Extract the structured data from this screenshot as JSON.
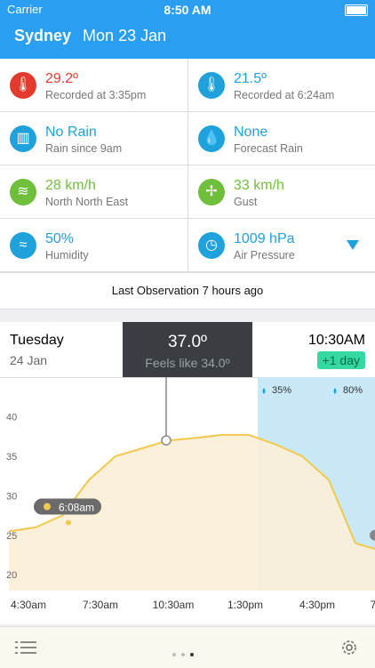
{
  "status": {
    "carrier": "Carrier",
    "time": "8:50 AM"
  },
  "header": {
    "city": "Sydney",
    "date": "Mon 23 Jan"
  },
  "cells": [
    {
      "value": "29.2º",
      "sub": "Recorded at 3:35pm",
      "color": "#e23b2e"
    },
    {
      "value": "21.5º",
      "sub": "Recorded at 6:24am",
      "color": "#1fa1dc"
    },
    {
      "value": "No Rain",
      "sub": "Rain since 9am",
      "color": "#1fa1dc"
    },
    {
      "value": "None",
      "sub": "Forecast Rain",
      "color": "#1fa1dc"
    },
    {
      "value": "28 km/h",
      "sub": "North North East",
      "color": "#6fbf3d"
    },
    {
      "value": "33 km/h",
      "sub": "Gust",
      "color": "#6fbf3d"
    },
    {
      "value": "50%",
      "sub": "Humidity",
      "color": "#1fa1dc"
    },
    {
      "value": "1009 hPa",
      "sub": "Air Pressure",
      "color": "#1fa1dc"
    }
  ],
  "observation": "Last Observation 7 hours ago",
  "chart_header": {
    "day": "Tuesday",
    "date": "24 Jan",
    "temp": "37.0º",
    "feels": "Feels like 34.0º",
    "time": "10:30AM",
    "offset": "+1 day"
  },
  "chart_data": {
    "type": "area",
    "ylim": [
      18,
      45
    ],
    "yticks": [
      "40",
      "35",
      "30",
      "25",
      "20"
    ],
    "xticks": [
      "4:30am",
      "7:30am",
      "10:30am",
      "1:30pm",
      "4:30pm",
      "7"
    ],
    "rain_labels": [
      "35%",
      "80%"
    ],
    "sunrise_label": "6:08am",
    "x": [
      "4:30am",
      "5:30am",
      "6:30am",
      "7:30am",
      "8:30am",
      "9:30am",
      "10:30am",
      "11:30am",
      "12:30pm",
      "1:30pm",
      "2:30pm",
      "3:30pm",
      "4:30pm",
      "5:30pm",
      "6:30pm"
    ],
    "temps": [
      25.5,
      26.0,
      27.5,
      32.0,
      35.0,
      36.0,
      37.0,
      37.3,
      37.7,
      37.7,
      36.5,
      35.0,
      32.0,
      24.0,
      23.0
    ]
  }
}
